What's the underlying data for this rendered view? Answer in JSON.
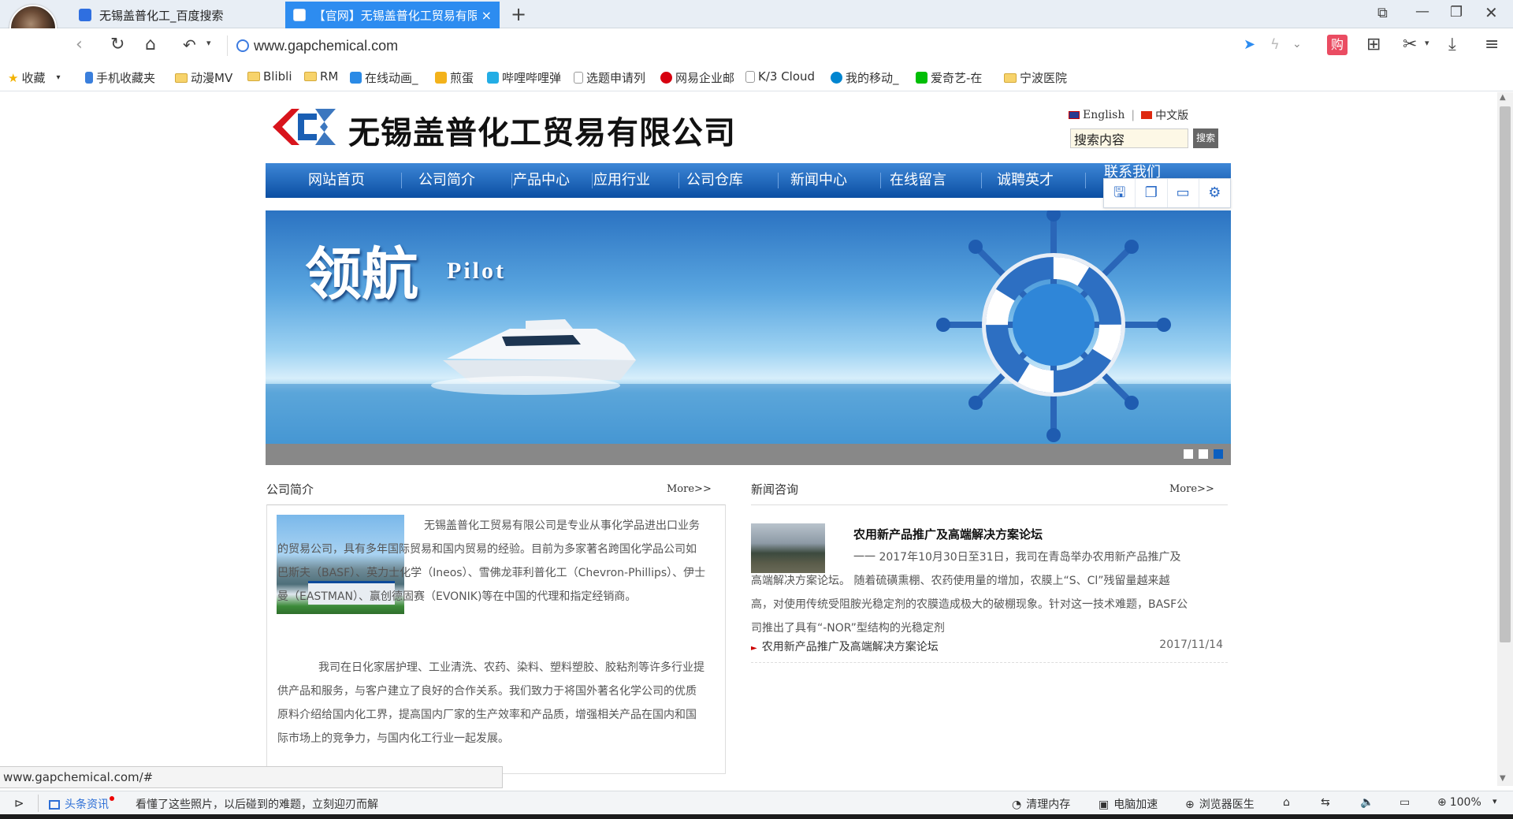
{
  "tabs": [
    {
      "label": "无锡盖普化工_百度搜索"
    },
    {
      "label": "【官网】无锡盖普化工贸易有限"
    }
  ],
  "address": {
    "url": "www.gapchemical.com"
  },
  "bookmarks": [
    {
      "label": "收藏"
    },
    {
      "label": "手机收藏夹"
    },
    {
      "label": "动漫MV"
    },
    {
      "label": "Blibli"
    },
    {
      "label": "RM"
    },
    {
      "label": "在线动画_"
    },
    {
      "label": "煎蛋"
    },
    {
      "label": "哔哩哔哩弹"
    },
    {
      "label": "选题申请列"
    },
    {
      "label": "网易企业邮"
    },
    {
      "label": "K/3 Cloud"
    },
    {
      "label": "我的移动_"
    },
    {
      "label": "爱奇艺-在"
    },
    {
      "label": "宁波医院"
    }
  ],
  "site": {
    "company_name": "无锡盖普化工贸易有限公司",
    "lang_english": "English",
    "lang_chinese": "中文版",
    "search_placeholder": "搜索内容",
    "search_button": "搜索",
    "nav": [
      "网站首页",
      "公司简介",
      "产品中心",
      "应用行业",
      "公司仓库",
      "新闻中心",
      "在线留言",
      "诚聘英才",
      "联系我们"
    ],
    "banner_title_cn": "领航",
    "banner_title_en": "Pilot",
    "about": {
      "title": "公司简介",
      "more": "More>>",
      "p1": "无锡盖普化工贸易有限公司是专业从事化学品进出口业务的贸易公司，具有多年国际贸易和国内贸易的经验。目前为多家著名跨国化学品公司如巴斯夫（BASF）、英力士化学（Ineos）、雪佛龙菲利普化工（Chevron-Phillips）、伊士曼（EASTMAN）、赢创德固赛（EVONIK)等在中国的代理和指定经销商。",
      "p2": "我司在日化家居护理、工业清洗、农药、染料、塑料塑胶、胶粘剂等许多行业提供产品和服务，与客户建立了良好的合作关系。我们致力于将国外著名化学公司的优质原料介绍给国内化工界，提高国内厂家的生产效率和产品质，增强相关产品在国内和国际市场上的竞争力，与国内化工行业一起发展。"
    },
    "news": {
      "title": "新闻咨询",
      "more": "More>>",
      "headline": "农用新产品推广及高端解决方案论坛",
      "summary": "一一 2017年10月30日至31日，我司在青岛举办农用新产品推广及高端解决方案论坛。 随着硫磺熏棚、农药使用量的增加，农膜上“S、Cl”残留量越来越高，对使用传统受阻胺光稳定剂的农膜造成极大的破棚现象。针对这一技术难题，BASF公司推出了具有“-NOR”型结构的光稳定剂",
      "items": [
        {
          "title": "农用新产品推广及高端解决方案论坛",
          "date": "2017/11/14"
        }
      ]
    }
  },
  "status": {
    "hover_url": "www.gapchemical.com/#",
    "news_label": "头条资讯",
    "ticker": "看懂了这些照片，以后碰到的难题，立刻迎刃而解",
    "clean_memory": "清理内存",
    "pc_speedup": "电脑加速",
    "browser_doctor": "浏览器医生",
    "zoom": "100%"
  }
}
